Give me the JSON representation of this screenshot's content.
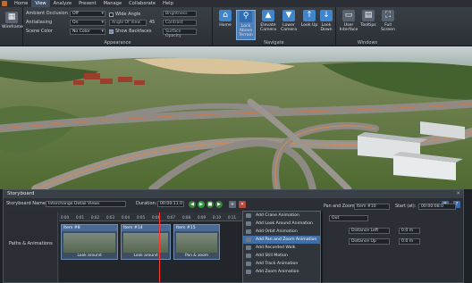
{
  "menu": {
    "items": [
      "Home",
      "View",
      "Analyze",
      "Present",
      "Manage",
      "Collaborate",
      "Help"
    ],
    "active_index": 1
  },
  "ribbon": {
    "wireframe_label": "Wireframe",
    "appearance": {
      "group_label": "Appearance",
      "ambient_occlusion": {
        "label": "Ambient Occlusion",
        "value": "Off"
      },
      "antialiasing": {
        "label": "Antialiasing",
        "value": "On"
      },
      "scene_color": {
        "label": "Scene Color",
        "value": "No Color"
      },
      "wide_angle": {
        "label": "Wide Angle",
        "checked": false
      },
      "angle_of_view": {
        "placeholder": "Angle Of View",
        "value": "45"
      },
      "show_backfaces": {
        "label": "Show Backfaces",
        "checked": true
      },
      "brightness": {
        "placeholder": "Brightness"
      },
      "contrast": {
        "placeholder": "Contrast"
      },
      "surface_opacity": {
        "placeholder": "Surface Opacity"
      }
    },
    "navigate": {
      "group_label": "Navigate",
      "buttons": [
        {
          "label": "Home",
          "icon": "home-icon",
          "active": false
        },
        {
          "label": "Lock Above Terrain",
          "icon": "lock-terrain-icon",
          "active": true
        },
        {
          "label": "Elevate Camera",
          "icon": "elevate-camera-icon",
          "active": false
        },
        {
          "label": "Lower Camera",
          "icon": "lower-camera-icon",
          "active": false
        },
        {
          "label": "Look Up",
          "icon": "look-up-icon",
          "active": false
        },
        {
          "label": "Look Down",
          "icon": "look-down-icon",
          "active": false
        }
      ]
    },
    "windows": {
      "group_label": "Windows",
      "buttons": [
        {
          "label": "User Interface",
          "icon": "user-interface-icon"
        },
        {
          "label": "Tooltips",
          "icon": "tooltips-icon"
        },
        {
          "label": "Full Screen",
          "icon": "full-screen-icon"
        }
      ]
    }
  },
  "storyboard": {
    "title": "Storyboard",
    "name_label": "Storyboard Name:",
    "name_value": "Interchange Detail Views",
    "duration_label": "Duration:",
    "duration_value": "00:00:11.0",
    "track_label": "Paths & Animations",
    "ruler_ticks": [
      "0:00",
      "0:01",
      "0:02",
      "0:03",
      "0:04",
      "0:05",
      "0:06",
      "0:07",
      "0:08",
      "0:09",
      "0:10",
      "0:11"
    ],
    "clips": [
      {
        "header": "Item #8",
        "caption": "Look around"
      },
      {
        "header": "Item #14",
        "caption": "Look around"
      },
      {
        "header": "Item #15",
        "caption": "Pan & zoom"
      }
    ]
  },
  "context_menu": {
    "items": [
      {
        "label": "Add Crane Animation",
        "highlighted": false
      },
      {
        "label": "Add Look Around Animation",
        "highlighted": false
      },
      {
        "label": "Add Orbit Animation",
        "highlighted": false
      },
      {
        "label": "Add Pan and Zoom Animation",
        "highlighted": true
      },
      {
        "label": "Add Recorded Walk",
        "highlighted": false
      },
      {
        "label": "Add Still Motion",
        "highlighted": false
      },
      {
        "label": "Add Track Animation",
        "highlighted": false
      },
      {
        "label": "Add Zoom Animation",
        "highlighted": false
      }
    ]
  },
  "properties": {
    "title": "Pan and Zoom:",
    "item_value": "Item #10",
    "start_label": "Start (at):",
    "start_value": "00:00:08.0",
    "curve_value": "Out",
    "distance_left_label": "Distance Left",
    "distance_left_value": "0.0 m",
    "distance_up_label": "Distance Up",
    "distance_up_value": "0.0 m"
  },
  "colors": {
    "accent": "#4f7fb8",
    "playhead": "#ff3b2f",
    "menu_highlight": "#3f6fa8"
  }
}
